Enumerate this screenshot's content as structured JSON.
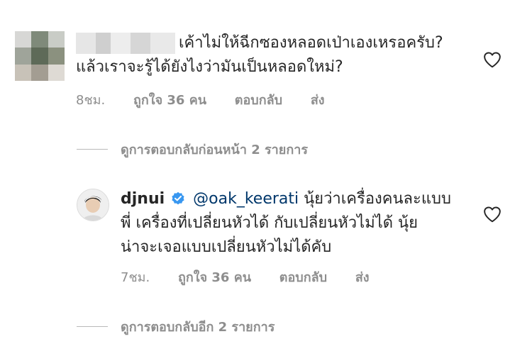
{
  "comment1": {
    "text_line1": "เค้าไม่ให้ฉีกซองหลอดเป่าเองเหรอครับ?",
    "text_line2": "แล้วเราจะรู้ได้ยังไงว่ามันเป็นหลอดใหม่?",
    "time": "8ชม.",
    "likes": "ถูกใจ 36 คน",
    "reply_label": "ตอบกลับ",
    "send_label": "ส่ง"
  },
  "replies_toggle_previous": "ดูการตอบกลับก่อนหน้า 2 รายการ",
  "reply": {
    "username": "djnui",
    "mention": "@oak_keerati",
    "text_line1_rest": " นุ้ยว่าเครื่องคนละแบบ",
    "text_line2": "พี่ เครื่องที่เปลี่ยนหัวได้ กับเปลี่ยนหัวไม่ได้  นุ้ย",
    "text_line3": "น่าจะเจอแบบเปลี่ยนหัวไม่ได้คับ",
    "time": "7ชม.",
    "likes": "ถูกใจ 36 คน",
    "reply_label": "ตอบกลับ",
    "send_label": "ส่ง"
  },
  "replies_toggle_more": "ดูการตอบกลับอีก 2 รายการ",
  "colors": {
    "text": "#262626",
    "muted": "#8e8e8e",
    "mention": "#00376b",
    "verified": "#3897f0"
  },
  "icons": {
    "like": "heart-outline-icon",
    "verified": "verified-badge-icon"
  }
}
